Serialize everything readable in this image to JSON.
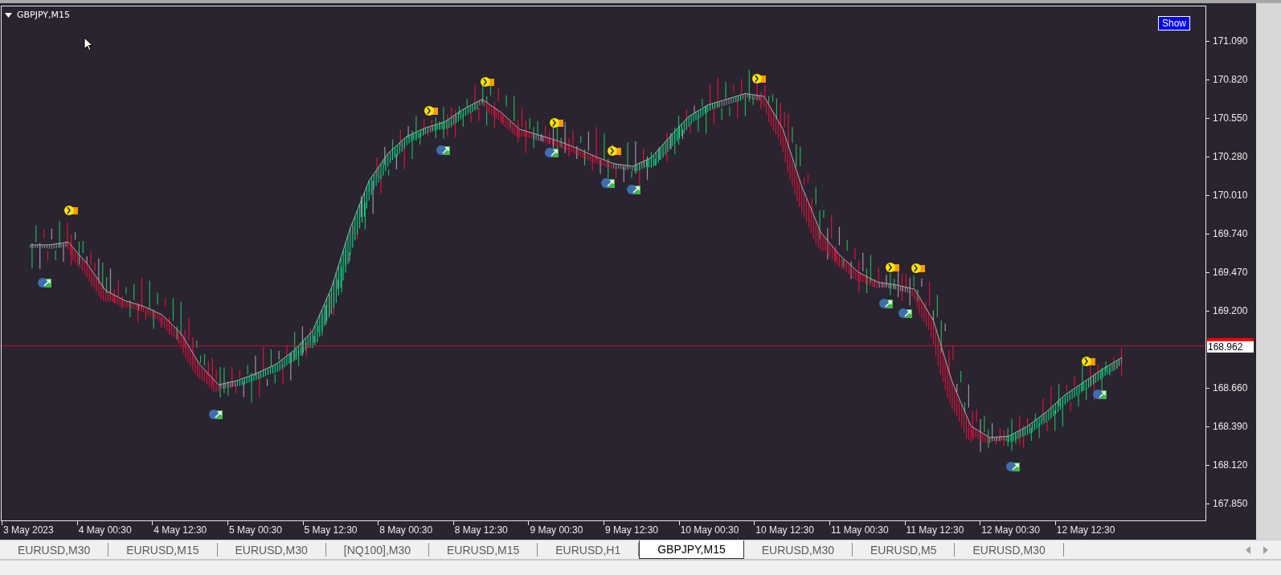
{
  "chart": {
    "title": "GBPJPY,M15",
    "show_button": "Show",
    "bid_label": "168.962",
    "chart_data": {
      "type": "line",
      "categories": [
        "3 May 2023",
        null,
        null,
        null,
        "4 May 00:30",
        null,
        null,
        null,
        "4 May 12:30",
        null,
        null,
        null,
        "5 May 00:30",
        null,
        null,
        null,
        "5 May 12:30",
        null,
        null,
        null,
        "8 May 00:30",
        null,
        null,
        null,
        "8 May 12:30",
        null,
        null,
        null,
        "9 May 00:30",
        null,
        null,
        null,
        "9 May 12:30",
        null,
        null,
        null,
        "10 May 00:30",
        null,
        null,
        null,
        "10 May 12:30",
        null,
        null,
        null,
        "11 May 00:30",
        null,
        null,
        null,
        "11 May 12:30",
        null,
        null,
        null,
        "12 May 00:30",
        null,
        null,
        null,
        "12 May 12:30",
        null,
        null,
        null,
        null,
        null,
        null,
        null,
        null
      ],
      "series": [
        {
          "color": "#a8a8b0",
          "values": [
            169.67,
            169.67,
            169.69,
            169.54,
            169.35,
            169.28,
            169.24,
            169.18,
            169.05,
            168.83,
            168.69,
            168.72,
            168.77,
            168.83,
            168.93,
            169.07,
            169.37,
            169.79,
            170.12,
            170.31,
            170.43,
            170.49,
            170.53,
            170.62,
            170.69,
            170.6,
            170.48,
            170.44,
            170.4,
            170.35,
            170.29,
            170.24,
            170.22,
            170.28,
            170.43,
            170.57,
            170.65,
            170.69,
            170.73,
            170.71,
            170.48,
            170.08,
            169.76,
            169.6,
            169.48,
            169.41,
            169.39,
            169.36,
            169.14,
            168.71,
            168.4,
            168.32,
            168.33,
            168.4,
            168.5,
            168.62,
            168.71,
            168.8,
            168.88,
            null,
            null,
            null,
            null,
            null,
            null
          ]
        }
      ],
      "ylim": [
        167.74,
        171.34
      ],
      "yticks": [
        {
          "value": 171.09,
          "label": "171.090"
        },
        {
          "value": 170.82,
          "label": "170.820"
        },
        {
          "value": 170.55,
          "label": "170.550"
        },
        {
          "value": 170.28,
          "label": "170.280"
        },
        {
          "value": 170.01,
          "label": "170.010"
        },
        {
          "value": 169.74,
          "label": "169.740"
        },
        {
          "value": 169.47,
          "label": "169.470"
        },
        {
          "value": 169.2,
          "label": "169.200"
        },
        {
          "value": 168.66,
          "label": "168.660"
        },
        {
          "value": 168.39,
          "label": "168.390"
        },
        {
          "value": 168.12,
          "label": "168.120"
        },
        {
          "value": 167.85,
          "label": "167.850"
        }
      ]
    }
  },
  "tabs": [
    {
      "label": "EURUSD,M30",
      "selected": false
    },
    {
      "label": "EURUSD,M15",
      "selected": false
    },
    {
      "label": "EURUSD,M30",
      "selected": false
    },
    {
      "label": "[NQ100],M30",
      "selected": false
    },
    {
      "label": "EURUSD,M15",
      "selected": false
    },
    {
      "label": "EURUSD,H1",
      "selected": false
    },
    {
      "label": "GBPJPY,M15",
      "selected": true
    },
    {
      "label": "EURUSD,M30",
      "selected": false
    },
    {
      "label": "EURUSD,M5",
      "selected": false
    },
    {
      "label": "EURUSD,M30",
      "selected": false
    }
  ]
}
